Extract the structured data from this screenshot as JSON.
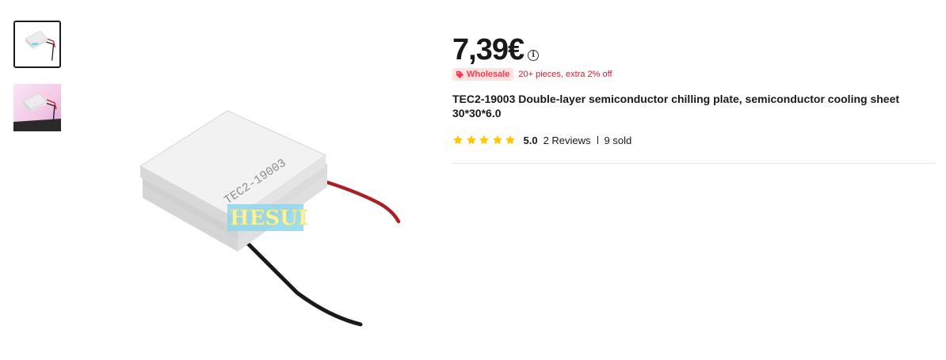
{
  "gallery": {
    "thumbnails": [
      {
        "name": "thumbnail-1",
        "active": true
      },
      {
        "name": "thumbnail-2",
        "active": false
      }
    ],
    "watermark": "HESUI",
    "module_marking": "TEC2-19003"
  },
  "product": {
    "price": "7,39€",
    "info_icon": "info-icon",
    "wholesale": {
      "label": "Wholesale",
      "text": "20+ pieces, extra 2% off",
      "icon": "tag-icon"
    },
    "title": "TEC2-19003 Double-layer semiconductor chilling plate, semiconductor cooling sheet 30*30*6.0",
    "rating": {
      "stars": 5,
      "value": "5.0",
      "reviews": "2 Reviews",
      "sold": "9 sold"
    }
  },
  "colors": {
    "star": "#ffc701",
    "wholesale_bg": "#ffe2e2",
    "wholesale_text": "#e2172c"
  }
}
